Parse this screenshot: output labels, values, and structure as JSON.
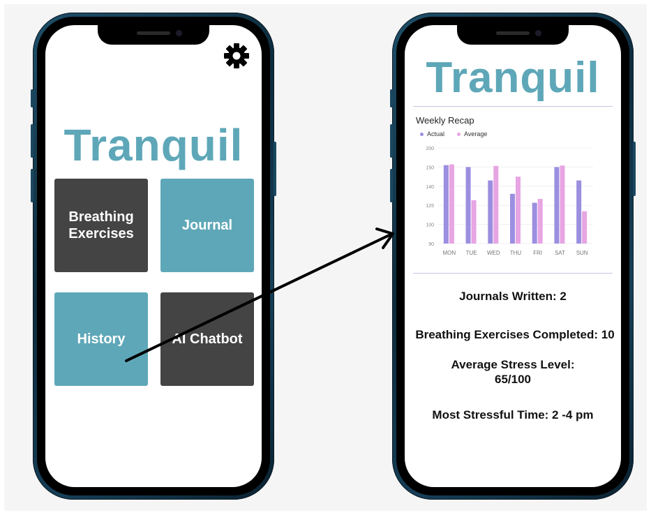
{
  "left_screen": {
    "brand": "Tranquil",
    "settings_icon": "gear-icon",
    "tiles": [
      {
        "label": "Breathing Exercises",
        "color": "#444444"
      },
      {
        "label": "Journal",
        "color": "#5ea7b8"
      },
      {
        "label": "History",
        "color": "#5ea7b8"
      },
      {
        "label": "AI Chatbot",
        "color": "#444444"
      }
    ]
  },
  "right_screen": {
    "brand": "Tranquil",
    "stats": {
      "journals": "Journals Written: 2",
      "breathing": "Breathing Exercises Completed: 10",
      "stress_label": "Average Stress Level:",
      "stress_value": "65/100",
      "stressful_time": "Most Stressful Time: 2 -4 pm"
    }
  },
  "chart_data": {
    "type": "bar",
    "title": "Weekly Recap",
    "categories": [
      "MON",
      "TUE",
      "WED",
      "THU",
      "FRI",
      "SAT",
      "SUN"
    ],
    "series": [
      {
        "name": "Actual",
        "color": "#9b8fe0",
        "values": [
          155,
          150,
          143,
          134,
          127,
          150,
          143
        ]
      },
      {
        "name": "Average",
        "color": "#e7a5e3",
        "values": [
          157,
          129,
          153,
          145,
          130,
          154,
          117
        ]
      }
    ],
    "yticks": [
      90,
      100,
      125,
      140,
      150,
      200
    ],
    "legend": "top-left",
    "grid": true
  },
  "colors": {
    "brand": "#5ea7b8",
    "dark_tile": "#444444",
    "accent_bar": "#9b8fe0",
    "average_bar": "#e7a5e3"
  }
}
